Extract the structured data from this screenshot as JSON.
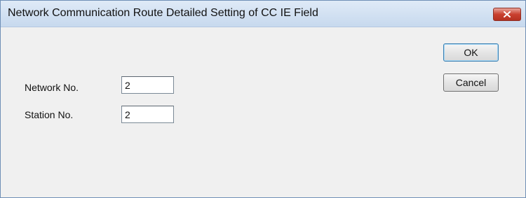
{
  "window": {
    "title": "Network Communication Route Detailed Setting of CC IE Field"
  },
  "form": {
    "network_no_label": "Network No.",
    "network_no_value": "2",
    "station_no_label": "Station No.",
    "station_no_value": "2"
  },
  "buttons": {
    "ok_label": "OK",
    "cancel_label": "Cancel"
  },
  "icons": {
    "close": "close-icon"
  },
  "colors": {
    "titlebar": "#c7d9ee",
    "close_button": "#c9402f",
    "client_background": "#f0f0f0"
  }
}
